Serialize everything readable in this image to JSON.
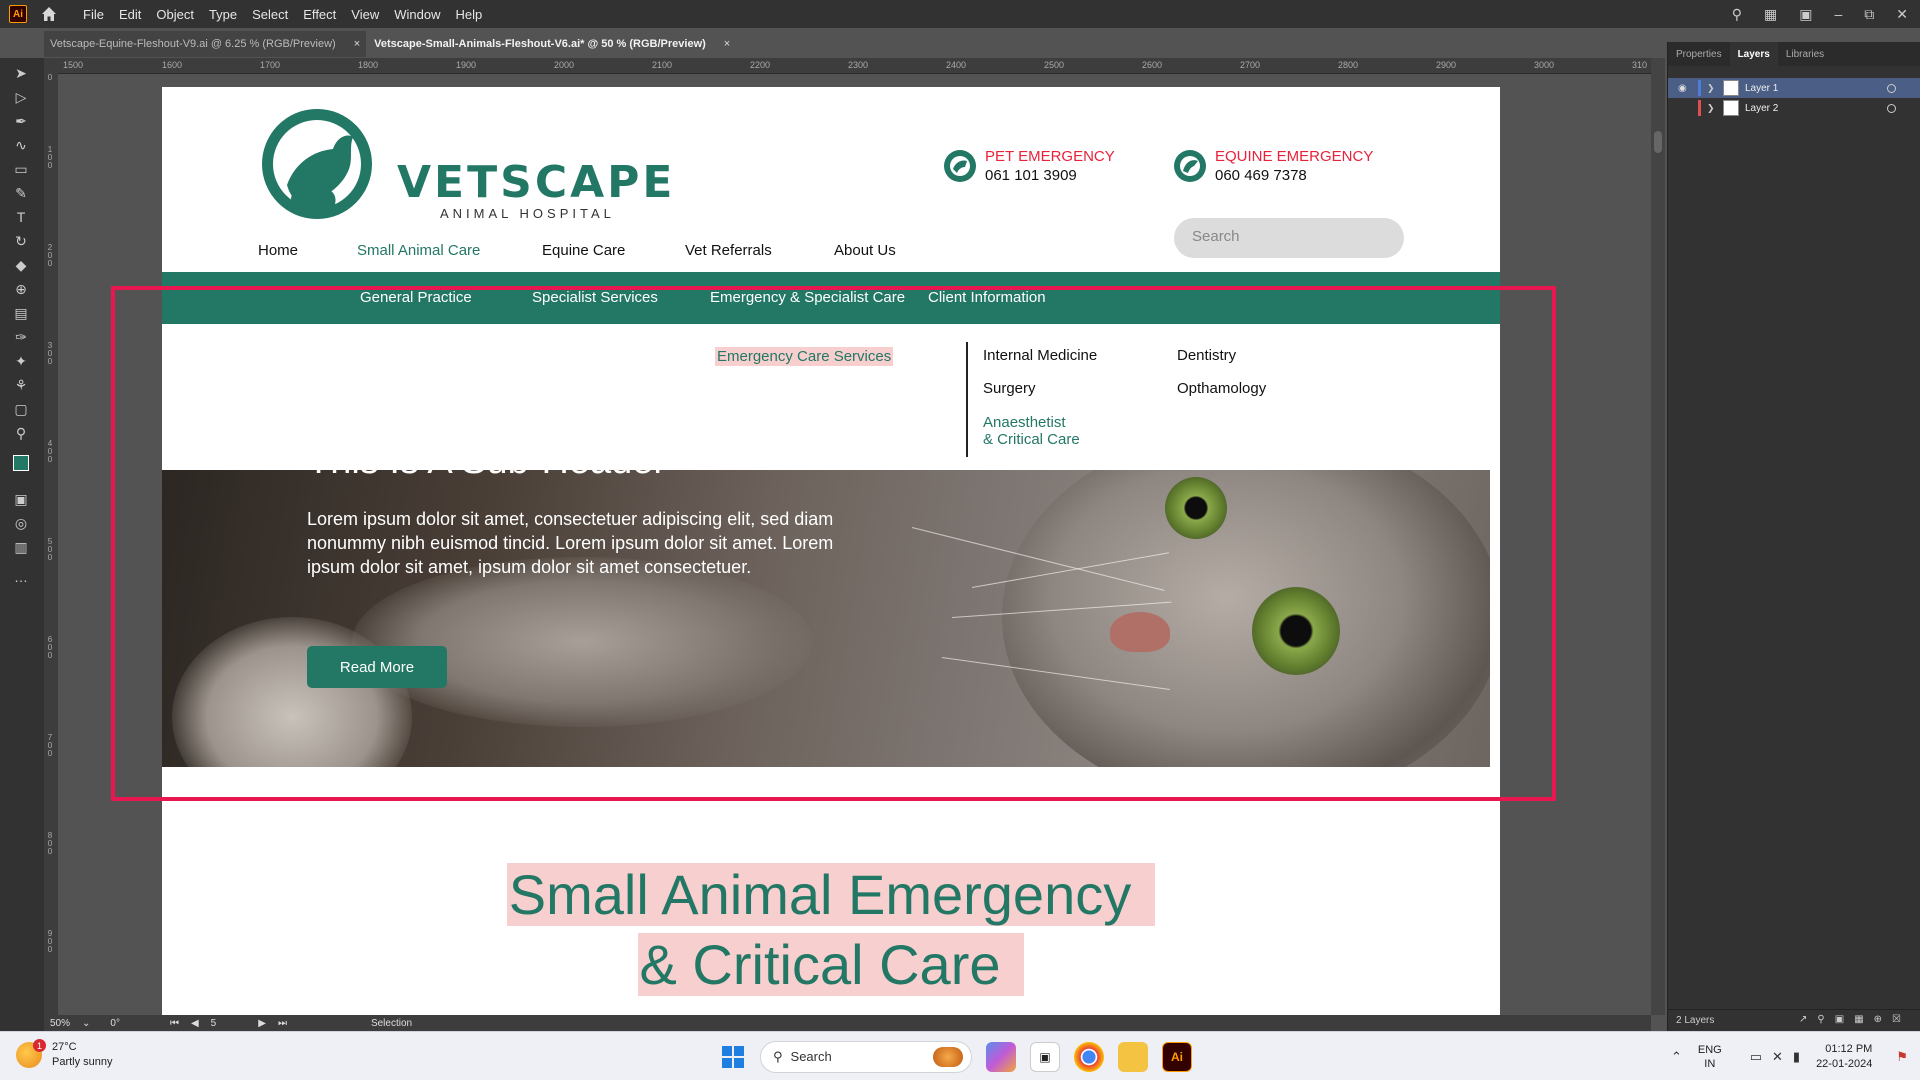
{
  "app": {
    "logo_text": "Ai",
    "menus": [
      "File",
      "Edit",
      "Object",
      "Type",
      "Select",
      "Effect",
      "View",
      "Window",
      "Help"
    ]
  },
  "tabs": [
    {
      "label": "Vetscape-Equine-Fleshout-V9.ai @ 6.25 % (RGB/Preview)",
      "close": "×"
    },
    {
      "label": "Vetscape-Small-Animals-Fleshout-V6.ai* @ 50 % (RGB/Preview)",
      "close": "×"
    }
  ],
  "ruler_top": [
    "1500",
    "1600",
    "1700",
    "1800",
    "1900",
    "2000",
    "2100",
    "2200",
    "2300",
    "2400",
    "2500",
    "2600",
    "2700",
    "2800",
    "2900",
    "3000",
    "310"
  ],
  "ruler_left": [
    "0",
    "1\n0\n0",
    "2\n0\n0",
    "3\n0\n0",
    "4\n0\n0",
    "5\n0\n0",
    "6\n0\n0",
    "7\n0\n0",
    "8\n0\n0",
    "9\n0\n0"
  ],
  "panel": {
    "tabs": [
      "Properties",
      "Layers",
      "Libraries"
    ],
    "layers": [
      {
        "name": "Layer 1",
        "color": "#4f7bd9"
      },
      {
        "name": "Layer 2",
        "color": "#e05050"
      }
    ],
    "footer": "2 Layers"
  },
  "status": {
    "zoom": "50%",
    "rotation": "0°",
    "artboard_num": "5",
    "tool": "Selection"
  },
  "site": {
    "brand_name": "VETSCAPE",
    "brand_sub": "ANIMAL HOSPITAL",
    "pet_label": "PET EMERGENCY",
    "pet_number": "061 101 3909",
    "equine_label": "EQUINE EMERGENCY",
    "equine_number": "060 469 7378",
    "search_placeholder": "Search",
    "nav": [
      "Home",
      "Small Animal Care",
      "Equine Care",
      "Vet Referrals",
      "About Us"
    ],
    "subnav": [
      "General Practice",
      "Specialist Services",
      "Emergency & Specialist Care",
      "Client Information"
    ],
    "mega_left": "Emergency Care Services",
    "mega_col1": [
      "Internal Medicine",
      "Surgery",
      "Anaesthetist",
      "& Critical Care"
    ],
    "mega_col2": [
      "Dentistry",
      "Opthamology"
    ],
    "sub_header": "This Is A Sub-Header",
    "hero_text": "Lorem ipsum dolor sit amet, consectetuer adipiscing elit, sed diam nonummy nibh euismod tincid. Lorem ipsum dolor sit amet. Lorem ipsum dolor sit amet,  ipsum dolor sit amet consectetuer.",
    "read_more": "Read More",
    "big_head_1": "Small Animal Emergency",
    "big_head_2": "& Critical Care",
    "brand_color": "#237765",
    "alert_color": "#e8223a"
  },
  "taskbar": {
    "temp": "27°C",
    "weather": "Partly sunny",
    "badge": "1",
    "search": "Search",
    "lang1": "ENG",
    "lang2": "IN",
    "time": "01:12 PM",
    "date": "22-01-2024",
    "ai_label": "Ai"
  }
}
